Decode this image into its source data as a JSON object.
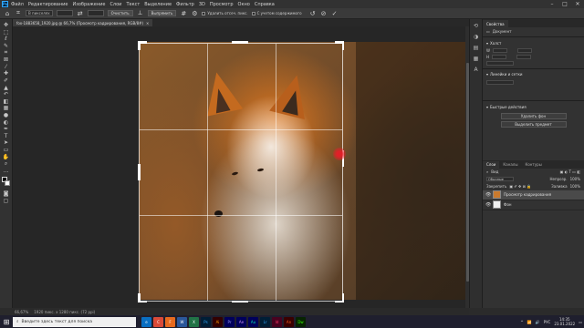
{
  "menubar": {
    "logo": "Ps",
    "items": [
      "Файл",
      "Редактирование",
      "Изображение",
      "Слои",
      "Текст",
      "Выделение",
      "Фильтр",
      "3D",
      "Просмотр",
      "Окно",
      "Справка"
    ],
    "window_controls": [
      "–",
      "□",
      "✕"
    ]
  },
  "options_bar": {
    "ratio_field": "В пикселях",
    "clear_button": "Очистить",
    "straighten_button": "Выпрямить",
    "delete_cropped": "Удалить отсеч. пикс.",
    "content_aware": "С учетом содержимого"
  },
  "document_tab": {
    "title": "fox-1883658_1920.jpg @ 66,7% (Просмотр кадрирования, RGB/8#)",
    "close": "×"
  },
  "status_bar": {
    "zoom": "66,67%",
    "info": "1920 пикс. x 1280 пикс. (72 ppi)"
  },
  "properties": {
    "tabs": [
      "Свойства"
    ],
    "doc_type": "Документ",
    "canvas_section": "Холст",
    "rulers_section": "Линейки и сетки",
    "quick_actions_section": "Быстрые действия",
    "remove_bg_button": "Удалить фон",
    "select_subject_button": "Выделить предмет"
  },
  "layers": {
    "tabs": [
      "Слои",
      "Каналы",
      "Контуры"
    ],
    "kind_label": "Вид",
    "blend_mode": "Обычные",
    "opacity_label": "Непрозр.",
    "opacity_value": "100%",
    "lock_label": "Закрепить",
    "fill_label": "Заливка",
    "fill_value": "100%",
    "items": [
      {
        "name": "Просмотр кадрирования",
        "selected": true
      },
      {
        "name": "Фон",
        "selected": false
      }
    ]
  },
  "taskbar": {
    "search_placeholder": "Введите здесь текст для поиска",
    "apps": [
      "e",
      "C",
      "F",
      "W",
      "X",
      "Ps",
      "Ai",
      "Pr",
      "Ae",
      "Au",
      "Lr",
      "Id",
      "An",
      "Dw"
    ],
    "lang": "РУС",
    "time": "14:35",
    "date": "23.01.2022"
  },
  "colors": {
    "photoshop_blue": "#31a8ff",
    "panel_bg": "#323232",
    "crop_handle": "#ffffff",
    "cursor_marker": "#e61e28"
  }
}
